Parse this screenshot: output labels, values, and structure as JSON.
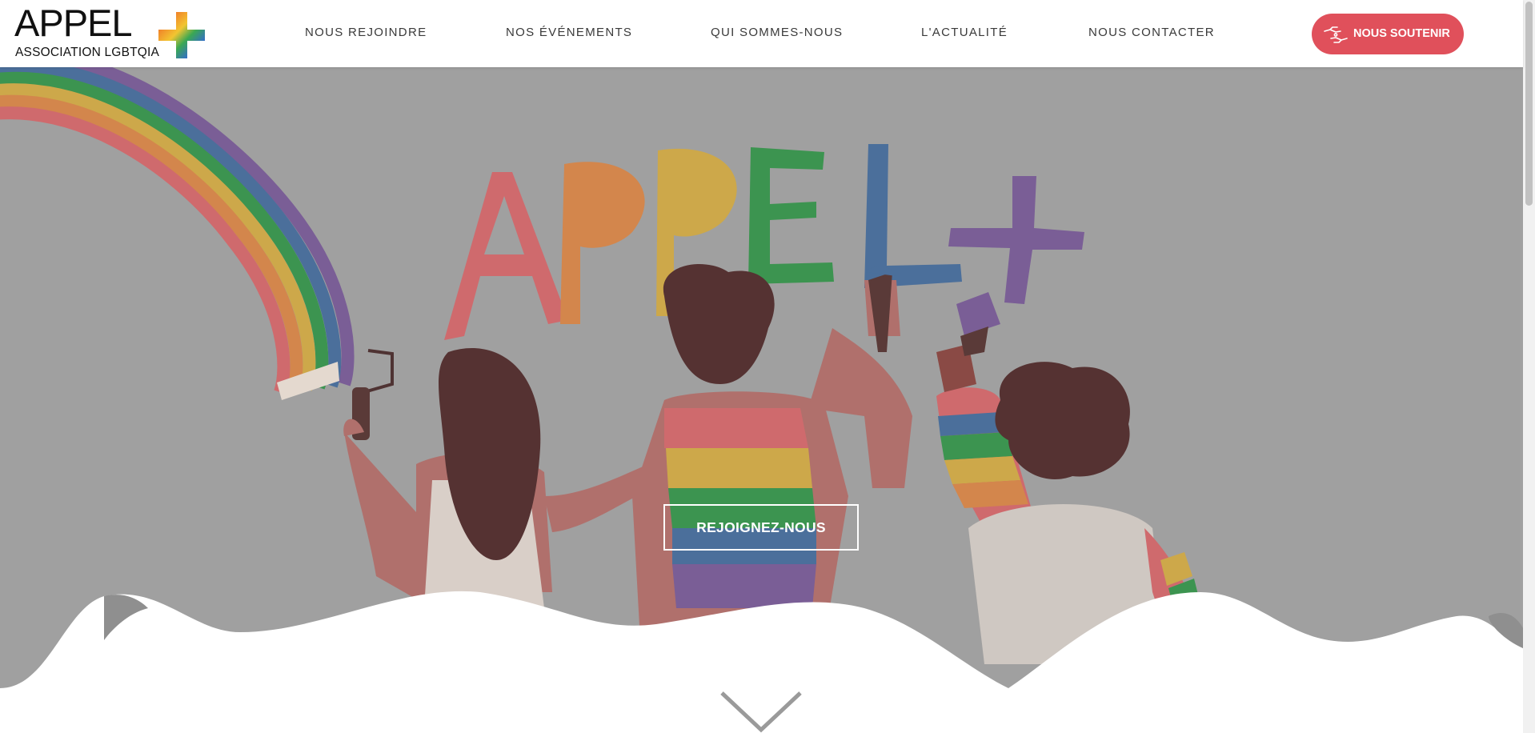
{
  "brand": {
    "title": "APPEL",
    "subtitle": "ASSOCIATION LGBTQIA",
    "plus_icon": "rainbow-plus-icon"
  },
  "nav": {
    "items": [
      {
        "label": "NOUS REJOINDRE"
      },
      {
        "label": "NOS ÉVÉNEMENTS"
      },
      {
        "label": "QUI SOMMES-NOUS"
      },
      {
        "label": "L'ACTUALITÉ"
      },
      {
        "label": "NOUS CONTACTER"
      }
    ],
    "support": {
      "label": "NOUS SOUTENIR",
      "icon": "donate-hands-icon"
    }
  },
  "hero": {
    "painted_wall_text": "APPEL+",
    "cta_label": "REJOIGNEZ-NOUS",
    "scroll_icon": "chevron-down-icon"
  },
  "colors": {
    "accent": "#e0505b",
    "hero_background": "#a0a0a0",
    "rainbow": [
      "#cf6a6d",
      "#d3864c",
      "#cda84a",
      "#3c9450",
      "#4b6f9b",
      "#7a5e96"
    ]
  }
}
